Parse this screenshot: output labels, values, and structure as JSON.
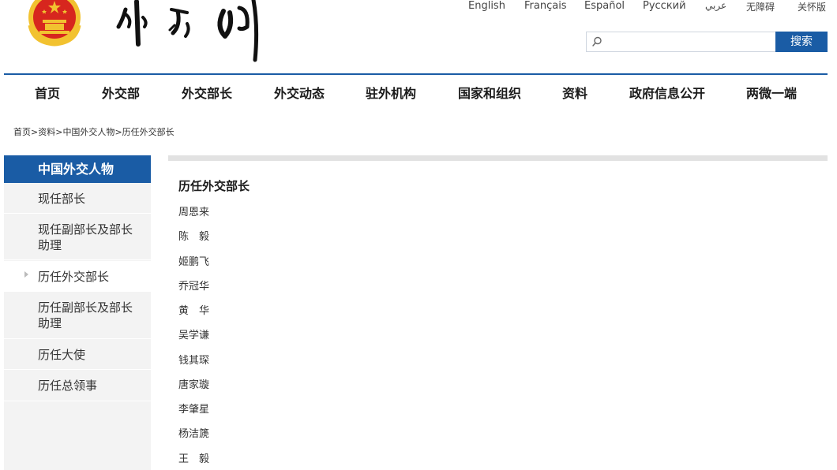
{
  "header": {
    "languages": [
      "English",
      "Français",
      "Español",
      "Русский",
      "عربي",
      "无障碍",
      "关怀版"
    ],
    "search": {
      "placeholder": "",
      "button_label": "搜索"
    }
  },
  "nav": {
    "items": [
      "首页",
      "外交部",
      "外交部长",
      "外交动态",
      "驻外机构",
      "国家和组织",
      "资料",
      "政府信息公开",
      "两微一端"
    ]
  },
  "breadcrumb": {
    "items": [
      "首页",
      "资料",
      "中国外交人物",
      "历任外交部长"
    ],
    "separator": ">"
  },
  "sidebar": {
    "heading": "中国外交人物",
    "items": [
      {
        "label": "现任部长"
      },
      {
        "label": "现任副部长及部长助理"
      },
      {
        "label": "历任外交部长",
        "active": true
      },
      {
        "label": "历任副部长及部长助理"
      },
      {
        "label": "历任大使"
      },
      {
        "label": "历任总领事"
      }
    ]
  },
  "content": {
    "title": "历任外交部长",
    "ministers": [
      "周恩来",
      "陈　毅",
      "姬鹏飞",
      "乔冠华",
      "黄　华",
      "吴学谦",
      "钱其琛",
      "唐家璇",
      "李肇星",
      "杨洁篪",
      "王　毅"
    ]
  },
  "colors": {
    "brand_blue": "#1a5ca5",
    "sidebar_bg": "#f3f3f3",
    "emblem_red": "#d7261e",
    "emblem_gold": "#f2c230"
  }
}
